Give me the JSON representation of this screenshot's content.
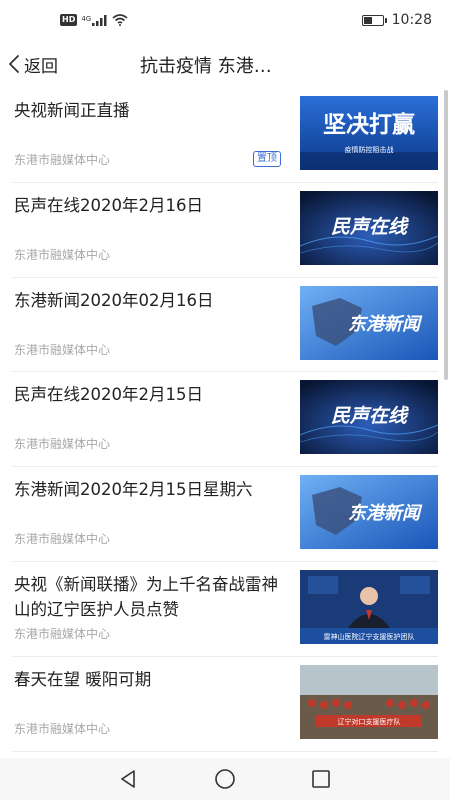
{
  "status_bar": {
    "hd": "HD",
    "network": "4G",
    "time": "10:28",
    "battery_level": 0.5
  },
  "header": {
    "back_label": "返回",
    "title": "抗击疫情  东港…"
  },
  "news": [
    {
      "title": "央视新闻正直播",
      "source": "东港市融媒体中心",
      "pinned_label": "置顶",
      "thumb_text": "坚决打赢",
      "thumb_sub": "疫情防控阻击战"
    },
    {
      "title": "民声在线2020年2月16日",
      "source": "东港市融媒体中心",
      "thumb_text": "民声在线"
    },
    {
      "title": "东港新闻2020年02月16日",
      "source": "东港市融媒体中心",
      "thumb_text": "东港新闻"
    },
    {
      "title": "民声在线2020年2月15日",
      "source": "东港市融媒体中心",
      "thumb_text": "民声在线"
    },
    {
      "title": "东港新闻2020年2月15日星期六",
      "source": "东港市融媒体中心",
      "thumb_text": "东港新闻"
    },
    {
      "title": "央视《新闻联播》为上千名奋战雷神山的辽宁医护人员点赞",
      "source": "东港市融媒体中心",
      "thumb_caption": "雷神山医院辽宁支援医护团队"
    },
    {
      "title": "春天在望 暖阳可期",
      "source": "东港市融媒体中心",
      "thumb_caption": "辽宁对口支援医疗队"
    }
  ],
  "colors": {
    "accent": "#3b6fd6",
    "thumb_blue": "#1a56b8",
    "thumb_dark": "#0c1a3e"
  }
}
